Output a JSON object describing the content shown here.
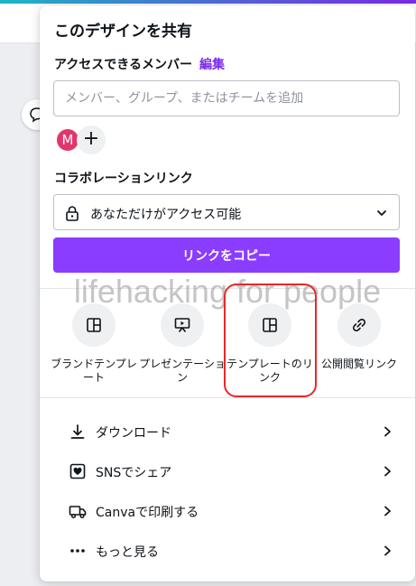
{
  "panel": {
    "title": "このデザインを共有",
    "access_label": "アクセスできるメンバー",
    "edit_link": "編集",
    "member_input_placeholder": "メンバー、グループ、またはチームを追加",
    "avatar_initial": "M",
    "add_symbol": "+",
    "collab_label": "コラボレーションリンク",
    "access_value": "あなただけがアクセス可能",
    "copy_button": "リンクをコピー",
    "watermark": "lifehacking for people",
    "options": [
      {
        "name": "brand-template",
        "label": "ブランドテンプレート",
        "icon": "template-icon"
      },
      {
        "name": "presentation",
        "label": "プレゼンテーション",
        "icon": "presentation-icon"
      },
      {
        "name": "template-link",
        "label": "テンプレートのリンク",
        "icon": "template-icon"
      },
      {
        "name": "public-view-link",
        "label": "公開閲覧リンク",
        "icon": "link-icon"
      }
    ],
    "actions": [
      {
        "name": "download",
        "label": "ダウンロード",
        "icon": "download-icon"
      },
      {
        "name": "sns-share",
        "label": "SNSでシェア",
        "icon": "heart-icon"
      },
      {
        "name": "canva-print",
        "label": "Canvaで印刷する",
        "icon": "truck-icon"
      },
      {
        "name": "more",
        "label": "もっと見る",
        "icon": "more-icon"
      }
    ]
  },
  "colors": {
    "accent": "#8b3dff",
    "edit_link": "#7d2ae8",
    "avatar": "#e2366b",
    "highlight": "#e8282b"
  }
}
